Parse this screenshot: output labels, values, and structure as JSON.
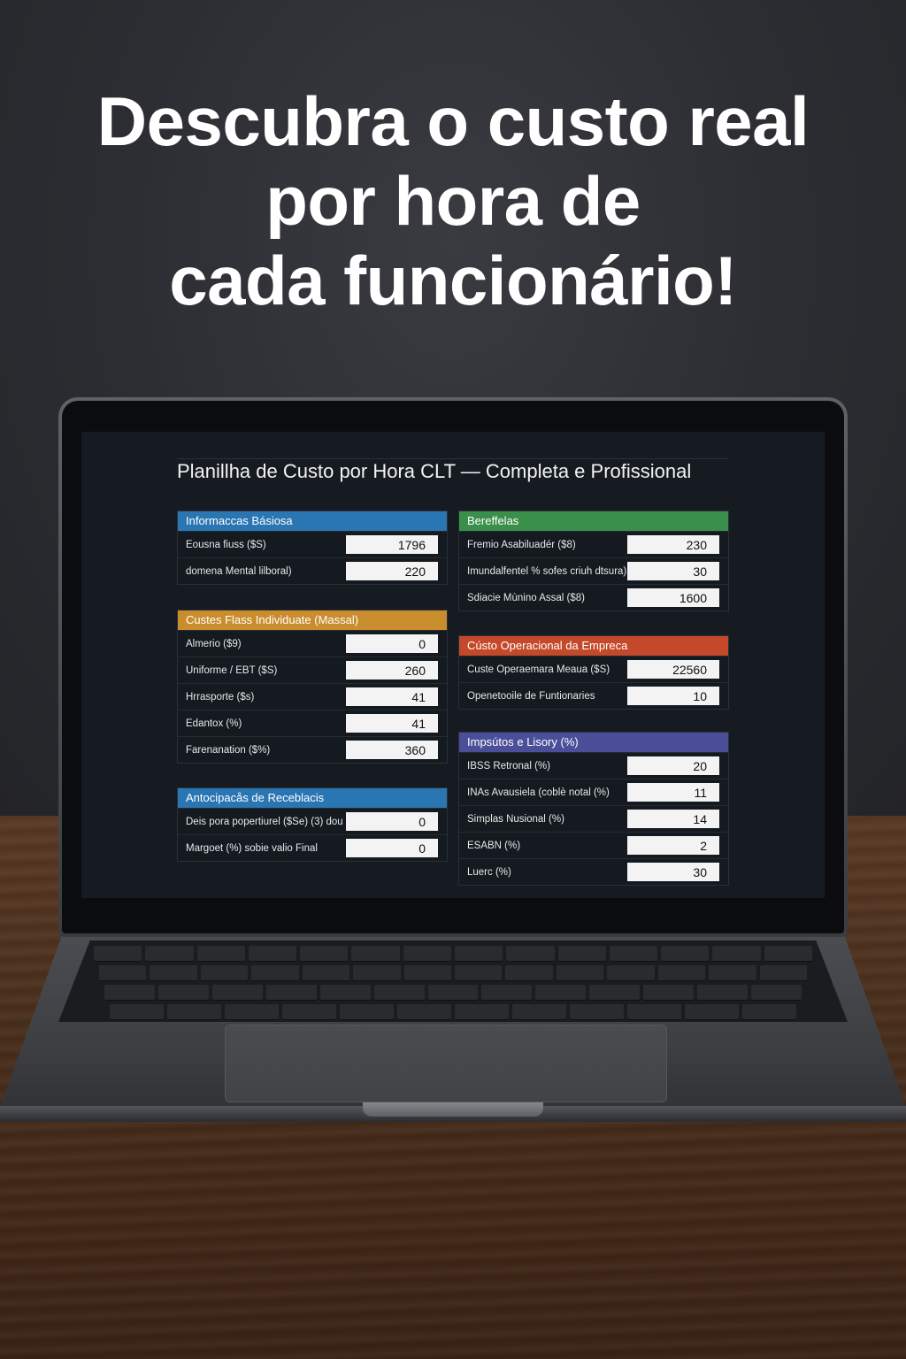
{
  "headline": [
    "Descubra o custo real",
    "por hora de",
    "cada funcionário!"
  ],
  "spreadsheet": {
    "title": "Planillha de Custo por Hora CLT — Completa e Profissional",
    "panels": {
      "info": {
        "title": "Informaccas Básiosa",
        "color": "#2a76b3",
        "rows": [
          {
            "label": "Eousna fiuss ($S)",
            "value": "1796"
          },
          {
            "label": "domena Mental lilboral)",
            "value": "220"
          }
        ]
      },
      "custos": {
        "title": "Custes Flass Individuate (Massal)",
        "color": "#c98d2e",
        "rows": [
          {
            "label": "Almerio ($9)",
            "value": "0"
          },
          {
            "label": "Uniforme / EBT ($S)",
            "value": "260"
          },
          {
            "label": "Hrrasporte ($s)",
            "value": "41"
          },
          {
            "label": "Edantox (%)",
            "value": "41"
          },
          {
            "label": "Farenanation ($%)",
            "value": "360"
          }
        ]
      },
      "antecip": {
        "title": "Antocipacås de Receblacis",
        "color": "#2a76b3",
        "rows": [
          {
            "label": "Deis pora popertiurel ($Se) (3) dou",
            "value": "0"
          },
          {
            "label": "Margoet (%) sobie valio Final",
            "value": "0"
          }
        ]
      },
      "benef": {
        "title": "Bereffelas",
        "color": "#3a8f4a",
        "rows": [
          {
            "label": "Fremio Asabiluadér ($8)",
            "value": "230"
          },
          {
            "label": "Imundalfentel % sofes criuh dtsura)",
            "value": "30"
          },
          {
            "label": "Sdiacie Mùnino Assal ($8)",
            "value": "1600"
          }
        ]
      },
      "operac": {
        "title": "Cústo Operacional da Empreca",
        "color": "#c4492a",
        "rows": [
          {
            "label": "Custe Operaemara Meaua ($S)",
            "value": "22560"
          },
          {
            "label": "Openetooile de Funtionaries",
            "value": "10"
          }
        ]
      },
      "impostos": {
        "title": "Impsútos e Lisory (%)",
        "color": "#4b4f9a",
        "rows": [
          {
            "label": "IBSS Retronal (%)",
            "value": "20"
          },
          {
            "label": "INAs Avausiela (coblè notal (%)",
            "value": "11"
          },
          {
            "label": "Simplas Nusional (%)",
            "value": "14"
          },
          {
            "label": "ESABN (%)",
            "value": "2"
          },
          {
            "label": "Luerc (%)",
            "value": "30"
          }
        ]
      }
    }
  }
}
